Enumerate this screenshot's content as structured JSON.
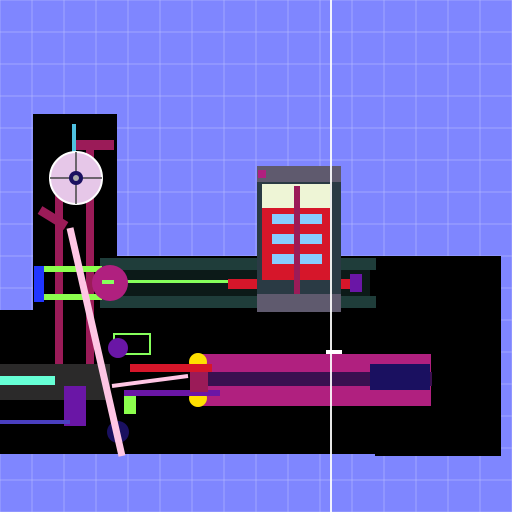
{
  "scene": {
    "description_tag": "",
    "colors": {
      "background": "#7f86ff",
      "grid": "#b9bdff",
      "void": "#000000",
      "wall": "#1f3d3a",
      "wall_edge": "#5a8b80",
      "beam": "#9b1b58",
      "magenta": "#b0207f",
      "purple": "#6a16a6",
      "red": "#d6162a",
      "yellow": "#ffe000",
      "pink": "#ffc6e4",
      "green": "#86ff5c",
      "lime": "#8cff4d",
      "cyan": "#66ffd5",
      "blue": "#2036ff",
      "white": "#ffffff",
      "cream": "#eef5d6",
      "navy": "#1a1060",
      "gray": "#5f5a6e"
    },
    "icons": [
      "gear-wheel-icon",
      "crank-arm-icon",
      "piston-icon",
      "cylinder-block-icon"
    ]
  }
}
